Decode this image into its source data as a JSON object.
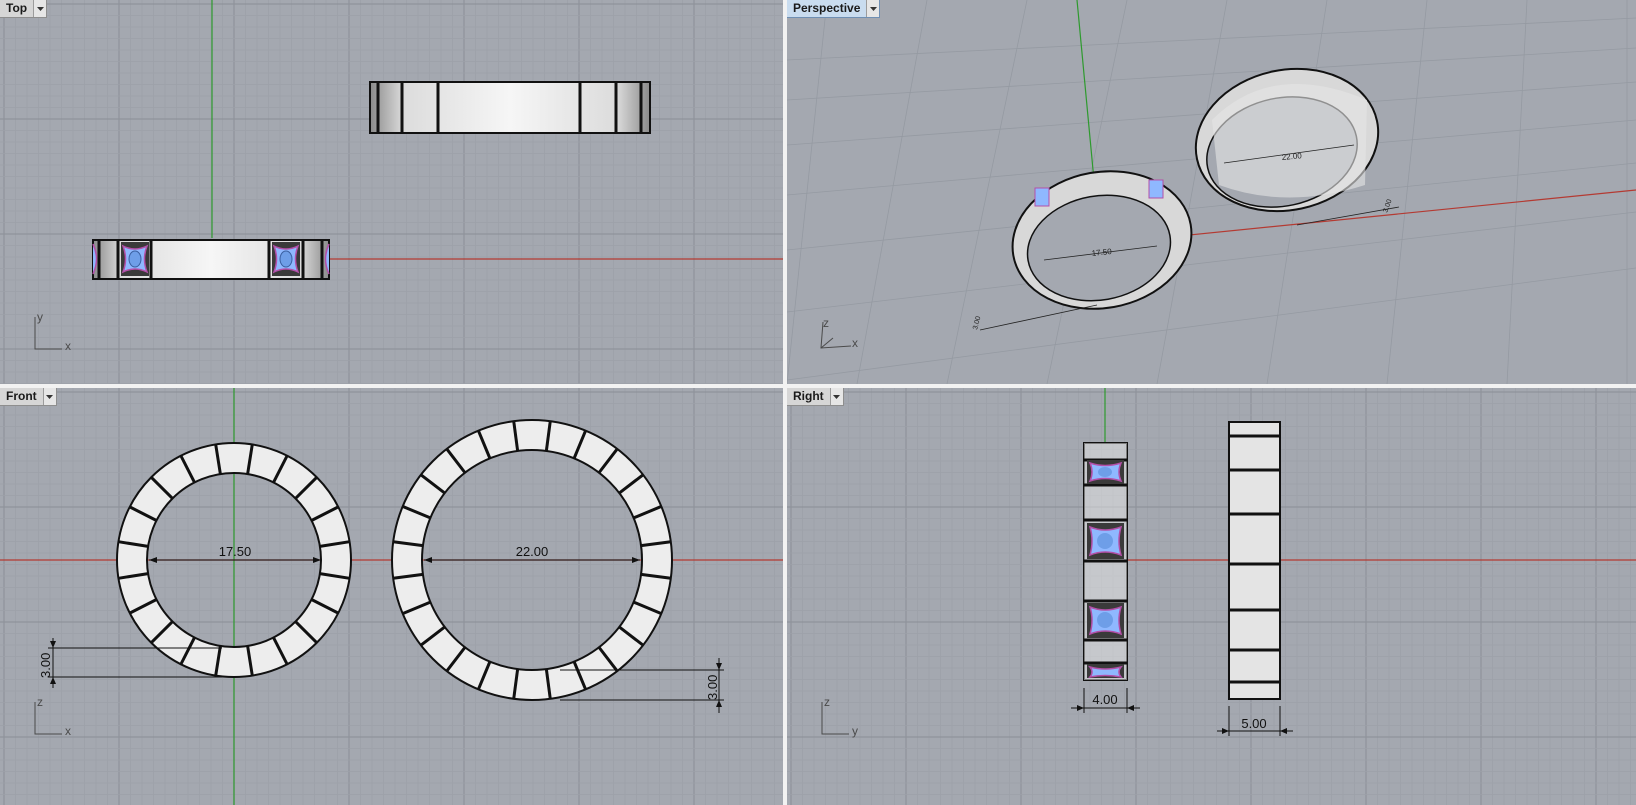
{
  "viewports": {
    "top": {
      "label": "Top",
      "axis_labels": {
        "h": "x",
        "v": "y"
      }
    },
    "perspective": {
      "label": "Perspective",
      "axis_labels": {
        "h": "x",
        "v": "z"
      },
      "dims": {
        "dia_small": "17.50",
        "dia_large": "22.00",
        "thick_small": "3.00",
        "thick_large": "3.00"
      }
    },
    "front": {
      "label": "Front",
      "axis_labels": {
        "h": "x",
        "v": "z"
      },
      "dims": {
        "dia_small": "17.50",
        "dia_large": "22.00",
        "thick_small": "3.00",
        "thick_large": "3.00"
      }
    },
    "right": {
      "label": "Right",
      "axis_labels": {
        "h": "y",
        "v": "z"
      },
      "dims": {
        "width_small": "4.00",
        "width_large": "5.00"
      }
    }
  },
  "colors": {
    "viewport_bg": "#a4a8b0",
    "grid_minor": "#9ca0a8",
    "grid_major": "#8f939b",
    "x_axis": "#b43a32",
    "y_axis": "#2e9a2e",
    "ring_fill": "#ededed",
    "gem_fill": "#8fb8ff",
    "gem_accent": "#b34fa8"
  },
  "icons": {
    "tab_menu": "dropdown-arrow-icon",
    "axes": "world-axes-icon"
  }
}
